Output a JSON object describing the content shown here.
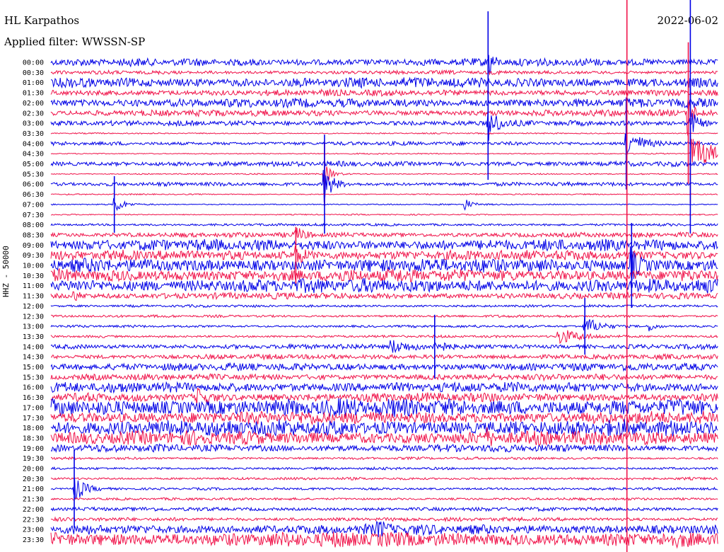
{
  "header": {
    "station": "HL Karpathos",
    "filter": "Applied filter: WWSSN-SP",
    "date": "2022-06-02"
  },
  "axis": {
    "ylabel": "HHZ - 50000"
  },
  "colors": {
    "blue": "#0000e6",
    "red": "#f0134a"
  },
  "chart_data": {
    "type": "line",
    "title": "",
    "xlabel": "",
    "ylabel": "HHZ - 50000",
    "ylabels": [
      "00:00",
      "00:30",
      "01:00",
      "01:30",
      "02:00",
      "02:30",
      "03:00",
      "03:30",
      "04:00",
      "04:30",
      "05:00",
      "05:30",
      "06:00",
      "06:30",
      "07:00",
      "07:30",
      "08:00",
      "08:30",
      "09:00",
      "09:30",
      "10:00",
      "10:30",
      "11:00",
      "11:30",
      "12:00",
      "12:30",
      "13:00",
      "13:30",
      "14:00",
      "14:30",
      "15:00",
      "15:30",
      "16:00",
      "16:30",
      "17:00",
      "17:30",
      "18:00",
      "18:30",
      "19:00",
      "19:30",
      "20:00",
      "20:30",
      "21:00",
      "21:30",
      "22:00",
      "22:30",
      "23:00",
      "23:30"
    ],
    "noise_level": [
      6,
      3,
      8,
      5,
      7,
      5,
      4,
      1,
      3,
      1,
      4,
      1,
      3,
      1,
      1,
      1,
      2,
      4,
      9,
      8,
      11,
      10,
      11,
      5,
      2,
      2,
      2,
      2,
      4,
      4,
      6,
      5,
      8,
      7,
      14,
      10,
      13,
      11,
      6,
      2,
      2,
      2,
      2,
      2,
      3,
      3,
      8,
      12
    ],
    "events": [
      {
        "row": 0,
        "t": 0.655,
        "a": 72,
        "d": 0.006
      },
      {
        "row": 6,
        "t": 0.655,
        "a": 80,
        "d": 0.012
      },
      {
        "row": 5,
        "t": 0.955,
        "a": 100,
        "d": 0.006
      },
      {
        "row": 6,
        "t": 0.958,
        "a": 55,
        "d": 0.01
      },
      {
        "row": 8,
        "t": 0.862,
        "a": 65,
        "d": 0.02
      },
      {
        "row": 9,
        "t": 0.958,
        "a": 70,
        "d": 0.04
      },
      {
        "row": 11,
        "t": 0.41,
        "a": 45,
        "d": 0.01
      },
      {
        "row": 12,
        "t": 0.41,
        "a": 70,
        "d": 0.012
      },
      {
        "row": 14,
        "t": 0.095,
        "a": 40,
        "d": 0.012
      },
      {
        "row": 14,
        "t": 0.62,
        "a": 25,
        "d": 0.01
      },
      {
        "row": 17,
        "t": 0.367,
        "a": 30,
        "d": 0.01
      },
      {
        "row": 19,
        "t": 0.367,
        "a": 40,
        "d": 0.01
      },
      {
        "row": 20,
        "t": 0.87,
        "a": 60,
        "d": 0.01
      },
      {
        "row": 23,
        "t": 0.035,
        "a": 20,
        "d": 0.008
      },
      {
        "row": 26,
        "t": 0.8,
        "a": 40,
        "d": 0.02
      },
      {
        "row": 26,
        "t": 0.898,
        "a": 20,
        "d": 0.008
      },
      {
        "row": 27,
        "t": 0.76,
        "a": 35,
        "d": 0.03
      },
      {
        "row": 28,
        "t": 0.51,
        "a": 25,
        "d": 0.02
      },
      {
        "row": 28,
        "t": 0.575,
        "a": 45,
        "d": 0.01
      },
      {
        "row": 33,
        "t": 0.22,
        "a": 28,
        "d": 0.015
      },
      {
        "row": 37,
        "t": 0.655,
        "a": 20,
        "d": 0.008
      },
      {
        "row": 42,
        "t": 0.035,
        "a": 55,
        "d": 0.015
      },
      {
        "row": 46,
        "t": 0.49,
        "a": 25,
        "d": 0.015
      }
    ]
  }
}
